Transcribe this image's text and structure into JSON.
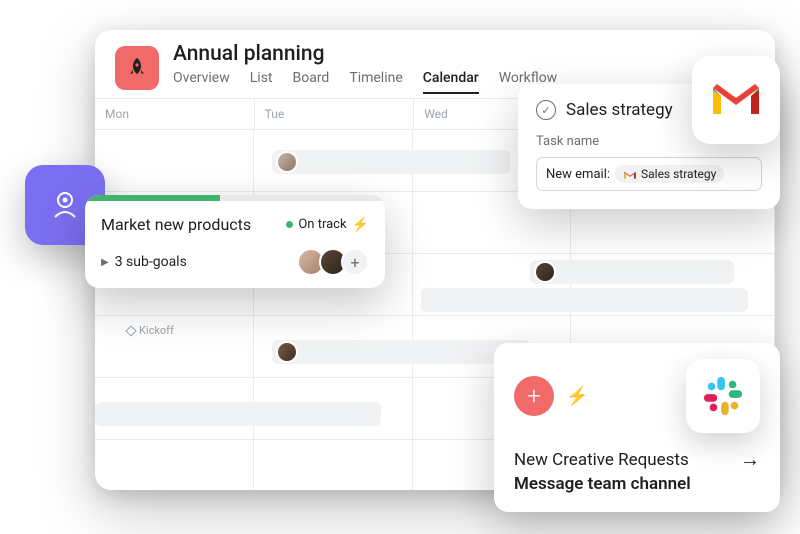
{
  "project": {
    "title": "Annual planning",
    "tabs": [
      "Overview",
      "List",
      "Board",
      "Timeline",
      "Calendar",
      "Workflow"
    ],
    "active_tab": "Calendar"
  },
  "calendar": {
    "days": [
      "Mon",
      "Tue",
      "Wed"
    ],
    "milestone_label": "Kickoff"
  },
  "goal": {
    "title": "Market new products",
    "status_label": "On track",
    "subgoals_label": "3 sub-goals"
  },
  "sales": {
    "title": "Sales strategy",
    "field_label": "Task name",
    "prefix": "New email:",
    "chip_text": "Sales strategy"
  },
  "slack": {
    "line1": "New Creative Requests",
    "line2": "Message team channel"
  }
}
